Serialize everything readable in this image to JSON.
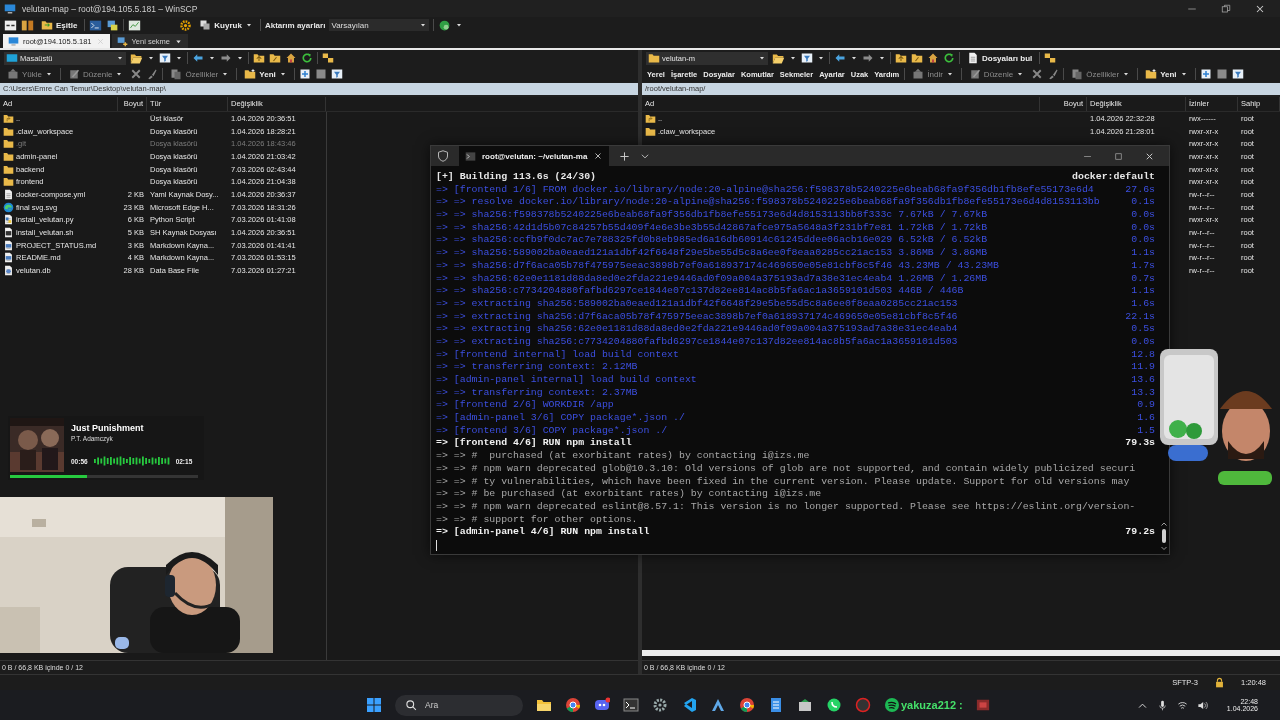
{
  "window": {
    "title": "velutan-map – root@194.105.5.181 – WinSCP"
  },
  "toolbar": {
    "sync_label": "Eşitle",
    "queue_label": "Kuyruk",
    "transfer_label": "Aktarım ayarları",
    "transfer_value": "Varsayılan"
  },
  "tabs": [
    {
      "label": "root@194.105.5.181",
      "selected": true
    },
    {
      "label": "Yeni sekme",
      "selected": false
    }
  ],
  "left_pane": {
    "location": "Masaüstü",
    "actions": [
      {
        "label": "Yükle",
        "disabled": true
      },
      {
        "label": "Düzenle",
        "disabled": true
      },
      {
        "label": "Özellikler",
        "disabled": true
      },
      {
        "label": "Yeni",
        "disabled": false
      }
    ],
    "path": "C:\\Users\\Emre Can Temur\\Desktop\\velutan-map\\",
    "columns": [
      "Ad",
      "Boyut",
      "Tür",
      "Değişiklik"
    ],
    "rows": [
      {
        "name": "..",
        "kind": "parent",
        "type": "Üst klasör",
        "modified": "1.04.2026 20:36:51",
        "hidden": false
      },
      {
        "name": ".claw_workspace",
        "kind": "folder",
        "type": "Dosya klasörü",
        "modified": "1.04.2026 18:28:21",
        "hidden": false
      },
      {
        "name": ".git",
        "kind": "folder",
        "type": "Dosya klasörü",
        "modified": "1.04.2026 18:43:46",
        "hidden": true
      },
      {
        "name": "admin-panel",
        "kind": "folder",
        "type": "Dosya klasörü",
        "modified": "1.04.2026 21:03:42",
        "hidden": false
      },
      {
        "name": "backend",
        "kind": "folder",
        "type": "Dosya klasörü",
        "modified": "7.03.2026 02:43:44",
        "hidden": false
      },
      {
        "name": "frontend",
        "kind": "folder",
        "type": "Dosya klasörü",
        "modified": "1.04.2026 21:04:38",
        "hidden": false
      },
      {
        "name": "docker-compose.yml",
        "kind": "doc",
        "size": "2 KB",
        "type": "Yaml Kaynak Dosy...",
        "modified": "1.04.2026 20:36:37",
        "hidden": false
      },
      {
        "name": "final svg.svg",
        "kind": "edge",
        "size": "23 KB",
        "type": "Microsoft Edge H...",
        "modified": "7.03.2026 18:31:26",
        "hidden": false
      },
      {
        "name": "install_velutan.py",
        "kind": "python",
        "size": "6 KB",
        "type": "Python Script",
        "modified": "7.03.2026 01:41:08",
        "hidden": false
      },
      {
        "name": "install_velutan.sh",
        "kind": "shell",
        "size": "5 KB",
        "type": "SH Kaynak Dosyası",
        "modified": "1.04.2026 20:36:51",
        "hidden": false
      },
      {
        "name": "PROJECT_STATUS.md",
        "kind": "markdown",
        "size": "3 KB",
        "type": "Markdown Kayna...",
        "modified": "7.03.2026 01:41:41",
        "hidden": false
      },
      {
        "name": "README.md",
        "kind": "markdown",
        "size": "4 KB",
        "type": "Markdown Kayna...",
        "modified": "7.03.2026 01:53:15",
        "hidden": false
      },
      {
        "name": "velutan.db",
        "kind": "db",
        "size": "28 KB",
        "type": "Data Base File",
        "modified": "7.03.2026 01:27:21",
        "hidden": false
      }
    ],
    "status": "0 B / 66,8 KB içinde 0 / 12"
  },
  "right_pane": {
    "location": "velutan-m",
    "find_label": "Dosyaları bul",
    "menu": [
      "Yerel",
      "İşaretle",
      "Dosyalar",
      "Komutlar",
      "Sekmeler",
      "Ayarlar",
      "Uzak",
      "Yardım"
    ],
    "actions": [
      {
        "label": "İndir",
        "disabled": true
      },
      {
        "label": "Düzenle",
        "disabled": true
      },
      {
        "label": "Özellikler",
        "disabled": true
      },
      {
        "label": "Yeni",
        "disabled": false
      }
    ],
    "path": "/root/velutan-map/",
    "columns": [
      "Ad",
      "Boyut",
      "Değişiklik",
      "İzinler",
      "Sahip"
    ],
    "rows": [
      {
        "name": "..",
        "kind": "parent",
        "modified": "1.04.2026 22:32:28",
        "permissions": "rwx------",
        "owner": "root"
      },
      {
        "name": ".claw_workspace",
        "kind": "folder",
        "modified": "1.04.2026 21:28:01",
        "permissions": "rwxr-xr-x",
        "owner": "root"
      },
      {
        "permissions": "rwxr-xr-x",
        "owner": "root"
      },
      {
        "permissions": "rwxr-xr-x",
        "owner": "root"
      },
      {
        "permissions": "rwxr-xr-x",
        "owner": "root"
      },
      {
        "permissions": "rwxr-xr-x",
        "owner": "root"
      },
      {
        "permissions": "rw-r--r--",
        "owner": "root"
      },
      {
        "permissions": "rw-r--r--",
        "owner": "root"
      },
      {
        "permissions": "rwxr-xr-x",
        "owner": "root"
      },
      {
        "permissions": "rw-r--r--",
        "owner": "root"
      },
      {
        "permissions": "rw-r--r--",
        "owner": "root"
      },
      {
        "permissions": "rw-r--r--",
        "owner": "root"
      },
      {
        "permissions": "rw-r--r--",
        "owner": "root"
      }
    ],
    "status": "0 B / 66,8 KB içinde 0 / 12"
  },
  "status_bar": {
    "protocol": "SFTP-3",
    "elapsed": "1:20:48"
  },
  "terminal": {
    "tab_title": "root@velutan: ~/velutan-ma",
    "header": "[+] Building 113.6s (24/30)",
    "context": "docker:default",
    "lines": [
      {
        "kind": "step",
        "text": "=> [frontend 1/6] FROM docker.io/library/node:20-alpine@sha256:f598378b5240225e6beab68fa9f356db1fb8efe55173e6d4",
        "time": "27.6s"
      },
      {
        "kind": "step",
        "text": "=> => resolve docker.io/library/node:20-alpine@sha256:f598378b5240225e6beab68fa9f356db1fb8efe55173e6d4d8153113bb",
        "time": "0.1s"
      },
      {
        "kind": "step",
        "text": "=> => sha256:f598378b5240225e6beab68fa9f356db1fb8efe55173e6d4d8153113bb8f333c 7.67kB / 7.67kB",
        "time": "0.0s"
      },
      {
        "kind": "step",
        "text": "=> => sha256:42d1d5b07c84257b55d409f4e6e3be3b55d42867afce975a5648a3f231bf7e81 1.72kB / 1.72kB",
        "time": "0.0s"
      },
      {
        "kind": "step",
        "text": "=> => sha256:ccfb9f0dc7ac7e788325fd0b8eb985ed6a16db60914c61245ddee06acb16e029 6.52kB / 6.52kB",
        "time": "0.0s"
      },
      {
        "kind": "step",
        "text": "=> => sha256:589002ba0eaed121a1dbf42f6648f29e5be55d5c8a6ee0f8eaa0285cc21ac153 3.86MB / 3.86MB",
        "time": "1.1s"
      },
      {
        "kind": "step",
        "text": "=> => sha256:d7f6aca05b78f475975eeac3898b7ef0a618937174c469650e05e81cbf8c5f46 43.23MB / 43.23MB",
        "time": "1.7s"
      },
      {
        "kind": "step",
        "text": "=> => sha256:62e0e1181d88da8ed0e2fda221e9446ad0f09a004a375193ad7a38e31ec4eab4 1.26MB / 1.26MB",
        "time": "0.7s"
      },
      {
        "kind": "step",
        "text": "=> => sha256:c7734204880fafbd6297ce1844e07c137d82ee814ac8b5fa6ac1a3659101d503 446B / 446B",
        "time": "1.1s"
      },
      {
        "kind": "step",
        "text": "=> => extracting sha256:589002ba0eaed121a1dbf42f6648f29e5be55d5c8a6ee0f8eaa0285cc21ac153",
        "time": "1.6s"
      },
      {
        "kind": "step",
        "text": "=> => extracting sha256:d7f6aca05b78f475975eeac3898b7ef0a618937174c469650e05e81cbf8c5f46",
        "time": "22.1s"
      },
      {
        "kind": "step",
        "text": "=> => extracting sha256:62e0e1181d88da8ed0e2fda221e9446ad0f09a004a375193ad7a38e31ec4eab4",
        "time": "0.5s"
      },
      {
        "kind": "step",
        "text": "=> => extracting sha256:c7734204880fafbd6297ce1844e07c137d82ee814ac8b5fa6ac1a3659101d503",
        "time": "0.0s"
      },
      {
        "kind": "step",
        "text": "=> [frontend internal] load build context",
        "time": "12.8"
      },
      {
        "kind": "step",
        "text": "=> => transferring context: 2.12MB",
        "time": "11.9"
      },
      {
        "kind": "step",
        "text": "=> [admin-panel internal] load build context",
        "time": "13.6"
      },
      {
        "kind": "step",
        "text": "=> => transferring context: 2.37MB",
        "time": "13.3"
      },
      {
        "kind": "step",
        "text": "=> [frontend 2/6] WORKDIR /app",
        "time": "0.9"
      },
      {
        "kind": "step",
        "text": "=> [admin-panel 3/6] COPY package*.json ./",
        "time": "1.6"
      },
      {
        "kind": "step",
        "text": "=> [frontend 3/6] COPY package*.json ./",
        "time": "1.5"
      },
      {
        "kind": "active",
        "text": "=> [frontend 4/6] RUN npm install",
        "time": "79.3s"
      },
      {
        "kind": "log",
        "text": "=> => #  purchased (at exorbitant rates) by contacting i@izs.me"
      },
      {
        "kind": "log",
        "text": "=> => # npm warn deprecated glob@10.3.10: Old versions of glob are not supported, and contain widely publicized securi"
      },
      {
        "kind": "log",
        "text": "=> => # ty vulnerabilities, which have been fixed in the current version. Please update. Support for old versions may"
      },
      {
        "kind": "log",
        "text": "=> => # be purchased (at exorbitant rates) by contacting i@izs.me"
      },
      {
        "kind": "log",
        "text": "=> => # npm warn deprecated eslint@8.57.1: This version is no longer supported. Please see https://eslint.org/version-"
      },
      {
        "kind": "log",
        "text": "=> => # support for other options."
      },
      {
        "kind": "active",
        "text": "=> [admin-panel 4/6] RUN npm install",
        "time": "79.2s"
      }
    ]
  },
  "music": {
    "title": "Just Punishment",
    "artist": "P.T. Adamczyk",
    "elapsed": "00:56",
    "duration": "02:15",
    "level": 0.41
  },
  "taskbar": {
    "search_placeholder": "Ara",
    "overlay_text": "yakuza212 :",
    "time": "22:48",
    "date": "1.04.2026"
  }
}
